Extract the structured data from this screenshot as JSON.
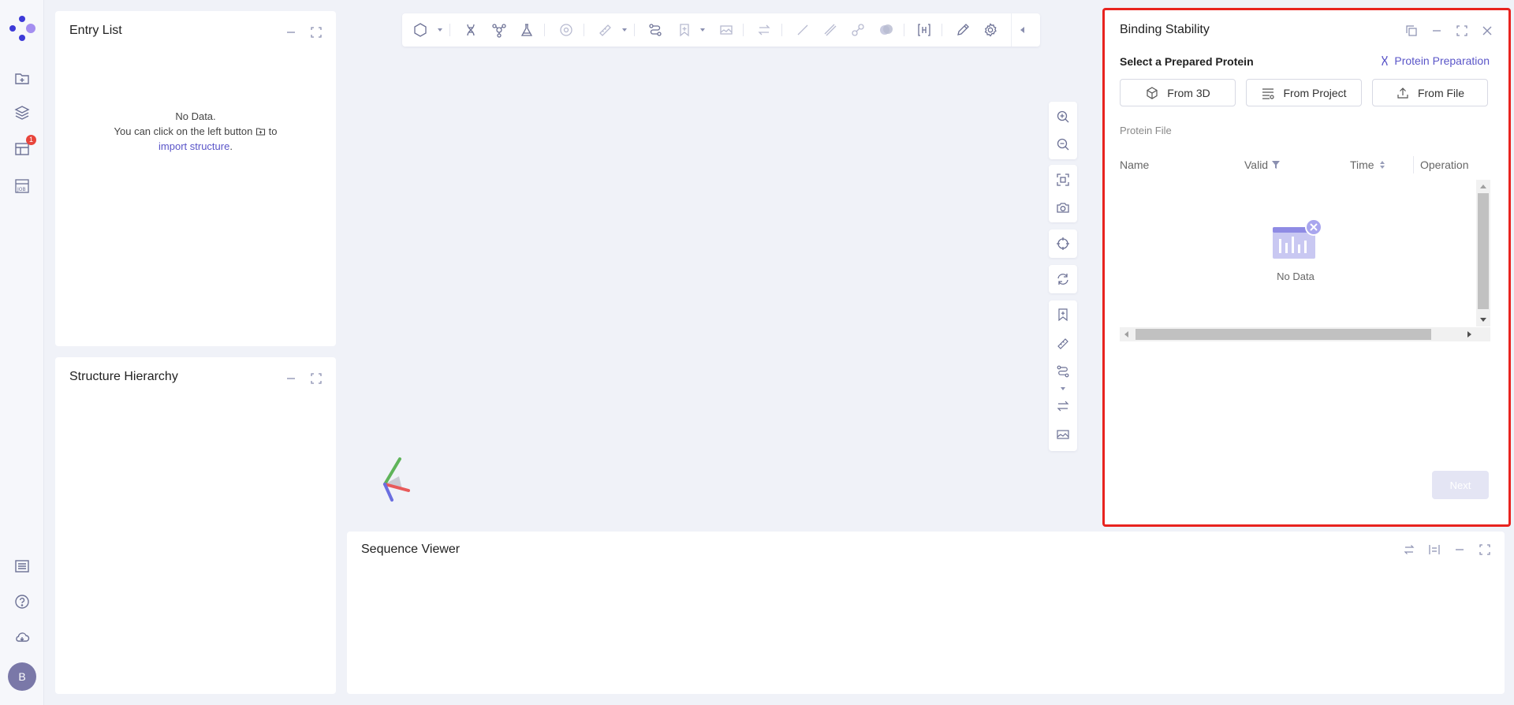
{
  "colors": {
    "accent": "#5a55c8",
    "highlight_border": "#e8231f",
    "badge": "#e8453c"
  },
  "rail": {
    "logo_icon": "app-logo-icon",
    "items": [
      {
        "name": "import-structure",
        "icon": "folder-plus-icon"
      },
      {
        "name": "layers",
        "icon": "layers-icon"
      },
      {
        "name": "table-view",
        "icon": "table-icon",
        "badge": "1"
      },
      {
        "name": "jobs",
        "icon": "job-icon"
      }
    ],
    "bottom": [
      {
        "name": "task-list",
        "icon": "list-icon"
      },
      {
        "name": "help",
        "icon": "help-circle-icon"
      },
      {
        "name": "cloud",
        "icon": "cloud-icon"
      }
    ],
    "avatar": "B"
  },
  "entry_list": {
    "title": "Entry List",
    "empty_line1": "No Data.",
    "empty_line2_pre": "You can click on the left button",
    "empty_line2_post": "to",
    "empty_link": "import structure",
    "empty_end": "."
  },
  "structure_hierarchy": {
    "title": "Structure Hierarchy"
  },
  "sequence_viewer": {
    "title": "Sequence Viewer"
  },
  "binding_stability": {
    "title": "Binding Stability",
    "select_label": "Select a Prepared Protein",
    "prep_link": "Protein Preparation",
    "buttons": {
      "from_3d": "From 3D",
      "from_project": "From Project",
      "from_file": "From File"
    },
    "protein_file_label": "Protein File",
    "columns": {
      "name": "Name",
      "valid": "Valid",
      "time": "Time",
      "operation": "Operation"
    },
    "empty_text": "No Data",
    "next_label": "Next"
  }
}
